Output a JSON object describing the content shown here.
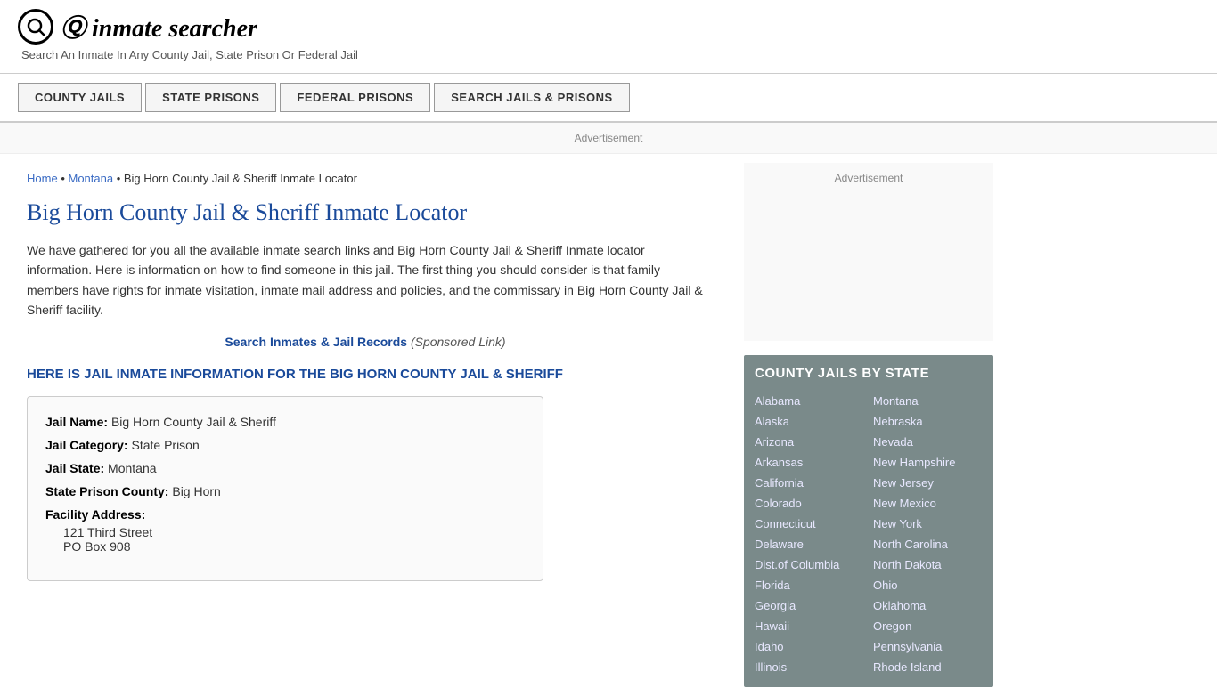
{
  "header": {
    "logo_icon": "🔍",
    "logo_text": "inmate searcher",
    "tagline": "Search An Inmate In Any County Jail, State Prison Or Federal Jail"
  },
  "nav": {
    "buttons": [
      {
        "label": "COUNTY JAILS",
        "id": "county-jails"
      },
      {
        "label": "STATE PRISONS",
        "id": "state-prisons"
      },
      {
        "label": "FEDERAL PRISONS",
        "id": "federal-prisons"
      },
      {
        "label": "SEARCH JAILS & PRISONS",
        "id": "search-jails"
      }
    ]
  },
  "ad_text": "Advertisement",
  "breadcrumb": {
    "home": "Home",
    "state": "Montana",
    "current": "Big Horn County Jail & Sheriff Inmate Locator"
  },
  "page_title": "Big Horn County Jail & Sheriff Inmate Locator",
  "description": "We have gathered for you all the available inmate search links and Big Horn County Jail & Sheriff Inmate locator information. Here is information on how to find someone in this jail. The first thing you should consider is that family members have rights for inmate visitation, inmate mail address and policies, and the commissary in Big Horn County Jail & Sheriff facility.",
  "search_link": {
    "text": "Search Inmates & Jail Records",
    "sponsored": "(Sponsored Link)"
  },
  "info_header": "HERE IS JAIL INMATE INFORMATION FOR THE BIG HORN COUNTY JAIL & SHERIFF",
  "jail_info": {
    "name_label": "Jail Name:",
    "name_value": "Big Horn County Jail & Sheriff",
    "category_label": "Jail Category:",
    "category_value": "State Prison",
    "state_label": "Jail State:",
    "state_value": "Montana",
    "county_label": "State Prison County:",
    "county_value": "Big Horn",
    "address_label": "Facility Address:",
    "address_line1": "121 Third Street",
    "address_line2": "PO Box 908"
  },
  "sidebar": {
    "ad_text": "Advertisement",
    "state_box_title": "COUNTY JAILS BY STATE",
    "states_left": [
      "Alabama",
      "Alaska",
      "Arizona",
      "Arkansas",
      "California",
      "Colorado",
      "Connecticut",
      "Delaware",
      "Dist.of Columbia",
      "Florida",
      "Georgia",
      "Hawaii",
      "Idaho",
      "Illinois"
    ],
    "states_right": [
      "Montana",
      "Nebraska",
      "Nevada",
      "New Hampshire",
      "New Jersey",
      "New Mexico",
      "New York",
      "North Carolina",
      "North Dakota",
      "Ohio",
      "Oklahoma",
      "Oregon",
      "Pennsylvania",
      "Rhode Island"
    ]
  }
}
